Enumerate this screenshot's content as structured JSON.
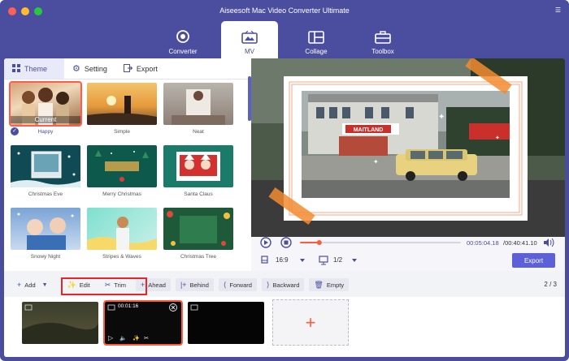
{
  "app": {
    "title": "Aiseesoft Mac Video Converter Ultimate"
  },
  "nav": {
    "tabs": [
      {
        "label": "Converter",
        "icon": "converter-icon"
      },
      {
        "label": "MV",
        "icon": "mv-icon"
      },
      {
        "label": "Collage",
        "icon": "collage-icon"
      },
      {
        "label": "Toolbox",
        "icon": "toolbox-icon"
      }
    ],
    "active": "MV"
  },
  "subtabs": [
    {
      "label": "Theme",
      "icon": "theme-grid-icon"
    },
    {
      "label": "Setting",
      "icon": "gear-icon"
    },
    {
      "label": "Export",
      "icon": "export-icon"
    }
  ],
  "themes": [
    {
      "label": "Happy",
      "badge": "Current"
    },
    {
      "label": "Simple"
    },
    {
      "label": "Neat"
    },
    {
      "label": "Christmas Eve"
    },
    {
      "label": "Merry Christmas"
    },
    {
      "label": "Santa Claus"
    },
    {
      "label": "Snowy Night"
    },
    {
      "label": "Stripes & Waves"
    },
    {
      "label": "Christmas Tree"
    }
  ],
  "player": {
    "time_current": "00:05:04.18",
    "time_total": "/00:40:41.10",
    "progress": 0.12,
    "aspect": "16:9",
    "page": "1/2",
    "export_label": "Export",
    "sign_text": "MAITLAND"
  },
  "toolbar": {
    "add": "Add",
    "edit": "Edit",
    "trim": "Trim",
    "ahead": "Ahead",
    "behind": "Behind",
    "forward": "Forward",
    "backward": "Backward",
    "empty": "Empty",
    "pager_current": "2",
    "pager_sep": "/",
    "pager_total": "3"
  },
  "timeline": {
    "clip2_duration": "00:01:16"
  },
  "colors": {
    "accent": "#4b4e9e",
    "highlight": "#e8242b",
    "add_plus": "#ff5a3c"
  }
}
